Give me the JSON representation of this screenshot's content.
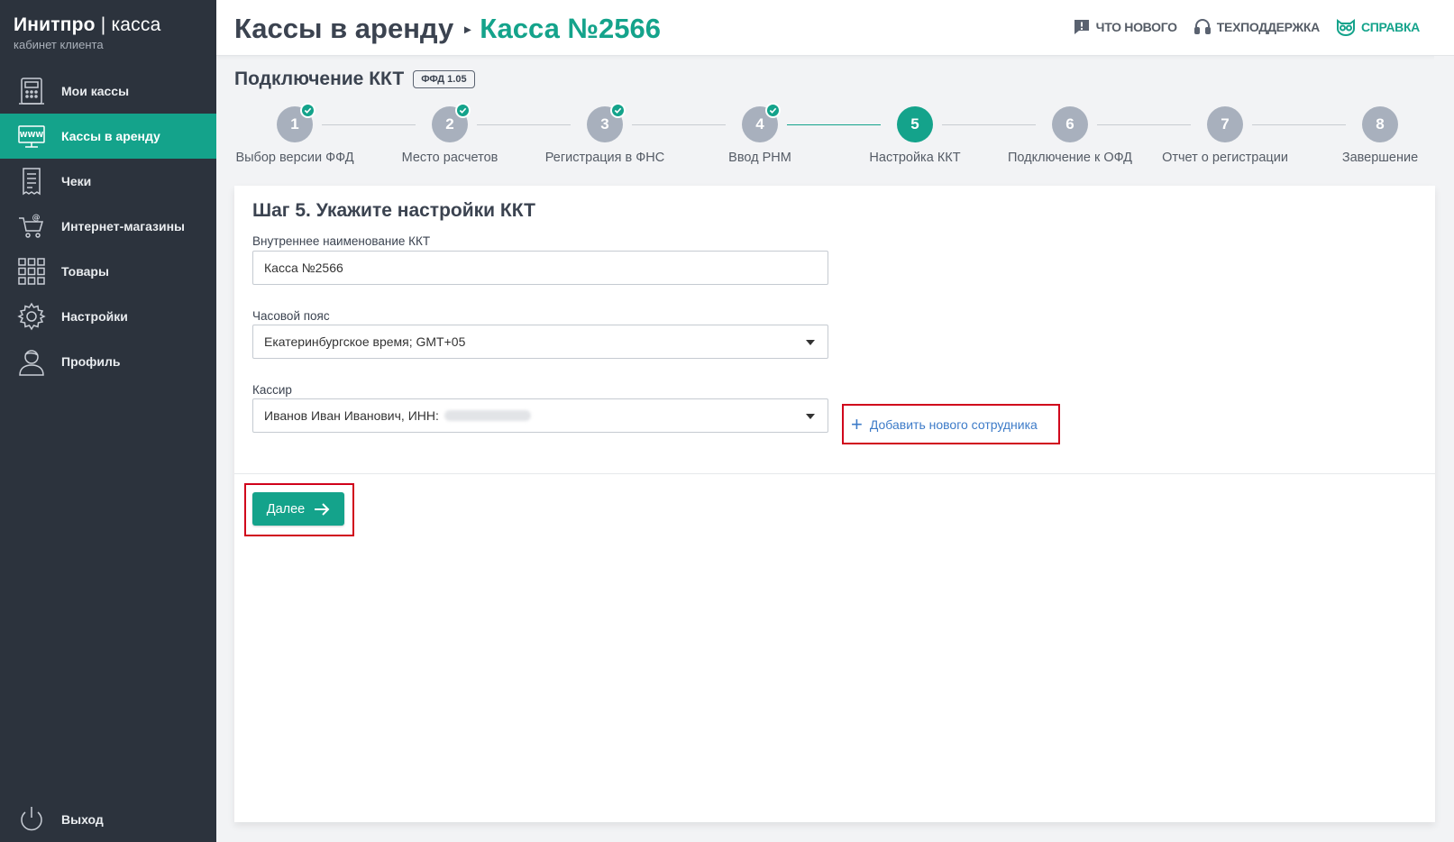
{
  "brand": {
    "name_bold": "Инитпро",
    "name_sep": " | ",
    "name_thin": "касса",
    "subtitle": "кабинет клиента"
  },
  "sidebar": {
    "items": [
      {
        "label": "Мои кассы",
        "icon": "cash-register-icon",
        "active": false
      },
      {
        "label": "Кассы в аренду",
        "icon": "www-monitor-icon",
        "active": true
      },
      {
        "label": "Чеки",
        "icon": "receipt-icon",
        "active": false
      },
      {
        "label": "Интернет-магазины",
        "icon": "shopping-cart-icon",
        "active": false
      },
      {
        "label": "Товары",
        "icon": "grid-icon",
        "active": false
      },
      {
        "label": "Настройки",
        "icon": "gear-icon",
        "active": false
      },
      {
        "label": "Профиль",
        "icon": "user-icon",
        "active": false
      }
    ],
    "logout_label": "Выход"
  },
  "header": {
    "breadcrumb_parent": "Кассы в аренду",
    "breadcrumb_current": "Касса №2566",
    "links": {
      "whats_new": "ЧТО НОВОГО",
      "support": "ТЕХПОДДЕРЖКА",
      "help": "СПРАВКА"
    }
  },
  "main": {
    "section_title": "Подключение ККТ",
    "ffd_badge": "ФФД 1.05",
    "steps": [
      {
        "number": "1",
        "label": "Выбор версии ФФД",
        "status": "done"
      },
      {
        "number": "2",
        "label": "Место расчетов",
        "status": "done"
      },
      {
        "number": "3",
        "label": "Регистрация в ФНС",
        "status": "done"
      },
      {
        "number": "4",
        "label": "Ввод РНМ",
        "status": "done"
      },
      {
        "number": "5",
        "label": "Настройка ККТ",
        "status": "current"
      },
      {
        "number": "6",
        "label": "Подключение к ОФД",
        "status": "pending"
      },
      {
        "number": "7",
        "label": "Отчет о регистрации",
        "status": "pending"
      },
      {
        "number": "8",
        "label": "Завершение",
        "status": "pending"
      }
    ],
    "form": {
      "title": "Шаг 5. Укажите настройки ККТ",
      "kkt_name_label": "Внутреннее наименование ККТ",
      "kkt_name_value": "Касса №2566",
      "timezone_label": "Часовой пояс",
      "timezone_value": "Екатеринбургское время; GMT+05",
      "cashier_label": "Кассир",
      "cashier_value": "Иванов  Иван Иванович, ИНН:",
      "add_employee_label": "Добавить нового сотрудника",
      "next_button_label": "Далее"
    }
  },
  "colors": {
    "accent": "#14a38b",
    "sidebar_bg": "#2c333d",
    "highlight": "#d0021b",
    "link": "#3d7bc8"
  }
}
